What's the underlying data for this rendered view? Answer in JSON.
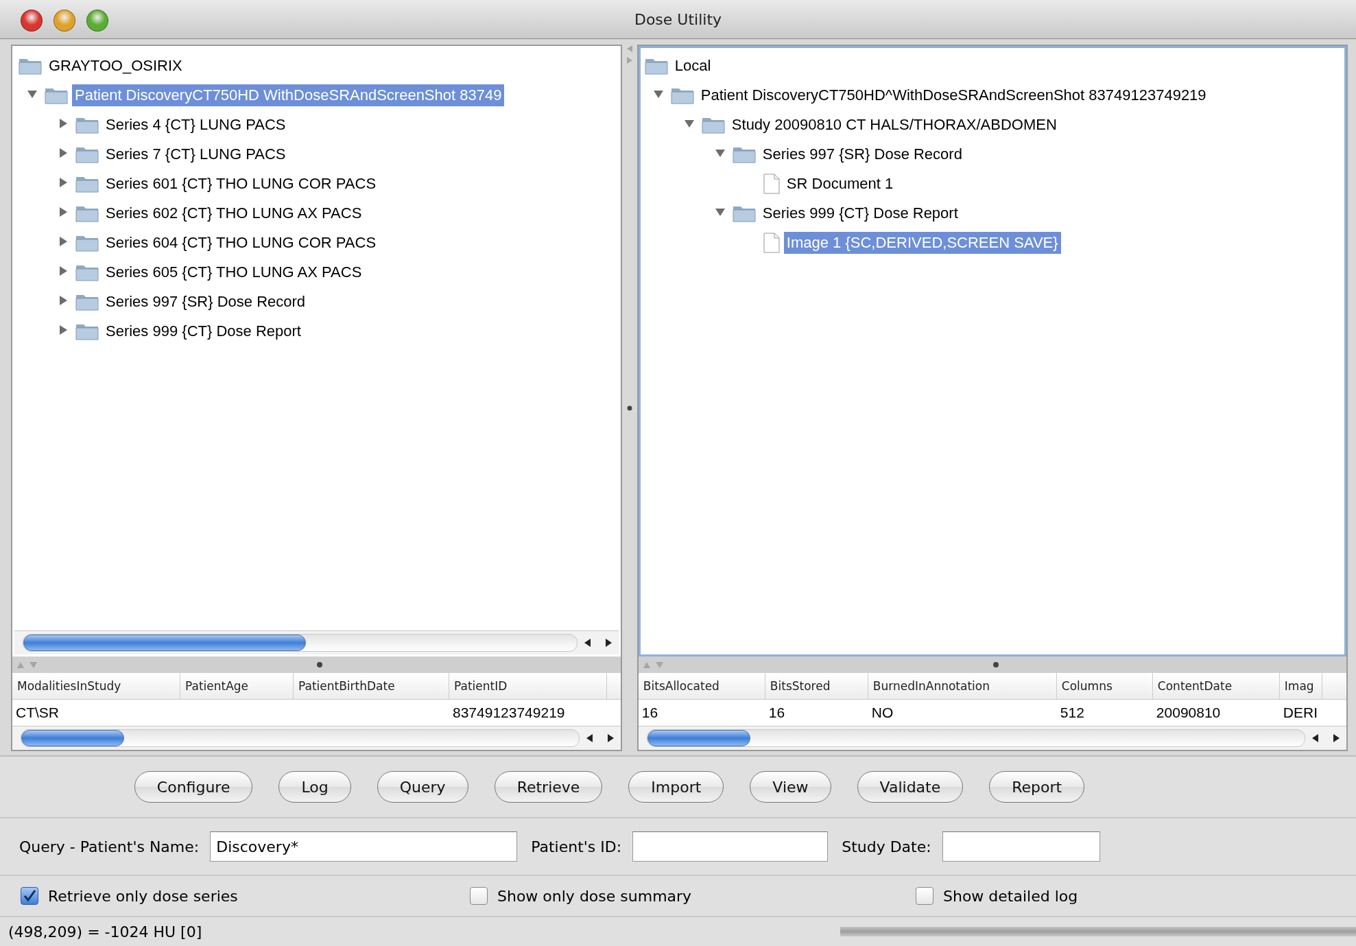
{
  "window": {
    "title": "Dose Utility"
  },
  "left_tree": {
    "label": "GRAYTOO_OSIRIX",
    "kind": "folder",
    "selected": false,
    "children": [
      {
        "label": "Patient DiscoveryCT750HD WithDoseSRAndScreenShot 83749",
        "kind": "folder",
        "expanded": true,
        "selected": true,
        "children": [
          {
            "label": "Series 4 {CT} LUNG PACS",
            "kind": "folder",
            "expanded": false,
            "selected": false
          },
          {
            "label": "Series 7 {CT} LUNG PACS",
            "kind": "folder",
            "expanded": false,
            "selected": false
          },
          {
            "label": "Series 601 {CT} THO LUNG COR PACS",
            "kind": "folder",
            "expanded": false,
            "selected": false
          },
          {
            "label": "Series 602 {CT} THO LUNG AX PACS",
            "kind": "folder",
            "expanded": false,
            "selected": false
          },
          {
            "label": "Series 604 {CT} THO LUNG COR PACS",
            "kind": "folder",
            "expanded": false,
            "selected": false
          },
          {
            "label": "Series 605 {CT} THO LUNG AX PACS",
            "kind": "folder",
            "expanded": false,
            "selected": false
          },
          {
            "label": "Series 997 {SR} Dose Record",
            "kind": "folder",
            "expanded": false,
            "selected": false
          },
          {
            "label": "Series 999 {CT} Dose Report",
            "kind": "folder",
            "expanded": false,
            "selected": false
          }
        ]
      }
    ]
  },
  "right_tree": {
    "label": "Local",
    "kind": "folder",
    "selected": false,
    "children": [
      {
        "label": "Patient DiscoveryCT750HD^WithDoseSRAndScreenShot 83749123749219",
        "kind": "folder",
        "expanded": true,
        "selected": false,
        "children": [
          {
            "label": "Study 20090810 CT HALS/THORAX/ABDOMEN",
            "kind": "folder",
            "expanded": true,
            "selected": false,
            "children": [
              {
                "label": "Series 997 {SR} Dose Record",
                "kind": "folder",
                "expanded": true,
                "selected": false,
                "children": [
                  {
                    "label": "SR Document 1",
                    "kind": "document",
                    "selected": false
                  }
                ]
              },
              {
                "label": "Series 999 {CT} Dose Report",
                "kind": "folder",
                "expanded": true,
                "selected": false,
                "children": [
                  {
                    "label": "Image 1 {SC,DERIVED,SCREEN SAVE}",
                    "kind": "document",
                    "selected": true
                  }
                ]
              }
            ]
          }
        ]
      }
    ]
  },
  "left_table": {
    "columns": [
      "ModalitiesInStudy",
      "PatientAge",
      "PatientBirthDate",
      "PatientID"
    ],
    "rows": [
      [
        "CT\\SR",
        "",
        "",
        "83749123749219"
      ]
    ]
  },
  "right_table": {
    "columns": [
      "BitsAllocated",
      "BitsStored",
      "BurnedInAnnotation",
      "Columns",
      "ContentDate",
      "Imag"
    ],
    "rows": [
      [
        "16",
        "16",
        "NO",
        "512",
        "20090810",
        "DERI"
      ]
    ]
  },
  "buttons": [
    "Configure",
    "Log",
    "Query",
    "Retrieve",
    "Import",
    "View",
    "Validate",
    "Report"
  ],
  "query": {
    "fields": [
      {
        "label": "Query - Patient's Name:",
        "value": "Discovery*"
      },
      {
        "label": "Patient's ID:"
      },
      {
        "label": "Study Date:"
      }
    ]
  },
  "options": [
    {
      "label": "Retrieve only dose series",
      "checked": true
    },
    {
      "label": "Show only dose summary",
      "checked": false
    },
    {
      "label": "Show detailed log",
      "checked": false
    }
  ],
  "status_bar": {
    "text": "(498,209) = -1024 HU [0]"
  }
}
